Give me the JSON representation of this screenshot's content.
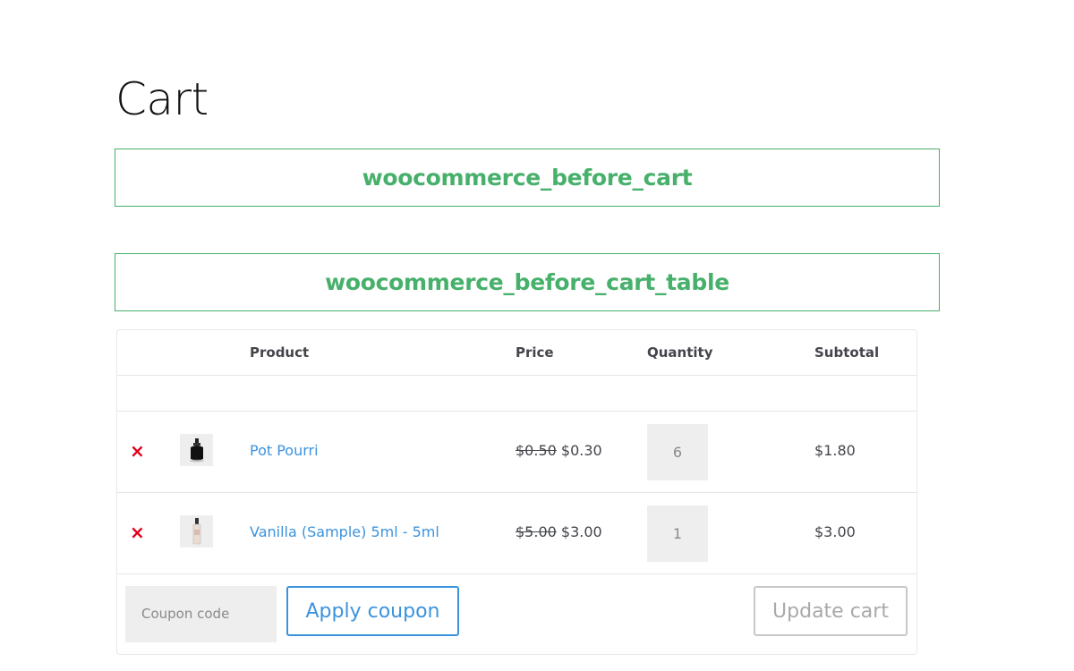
{
  "page": {
    "title": "Cart"
  },
  "hooks": {
    "before_cart": "woocommerce_before_cart",
    "before_cart_table": "woocommerce_before_cart_table"
  },
  "colors": {
    "hook": "#47b06b",
    "link": "#3b93dd",
    "remove": "#e2001a"
  },
  "table": {
    "headers": {
      "product": "Product",
      "price": "Price",
      "quantity": "Quantity",
      "subtotal": "Subtotal"
    },
    "rows": [
      {
        "remove_icon": "×",
        "thumbnail": "perfume-bottle-black",
        "name": "Pot Pourri",
        "regular_price": "$0.50",
        "sale_price": "$0.30",
        "quantity": "6",
        "subtotal": "$1.80"
      },
      {
        "remove_icon": "×",
        "thumbnail": "perfume-sample-vial",
        "name": "Vanilla (Sample) 5ml - 5ml",
        "regular_price": "$5.00",
        "sale_price": "$3.00",
        "quantity": "1",
        "subtotal": "$3.00"
      }
    ]
  },
  "actions": {
    "coupon_placeholder": "Coupon code",
    "apply_coupon": "Apply coupon",
    "update_cart": "Update cart"
  }
}
